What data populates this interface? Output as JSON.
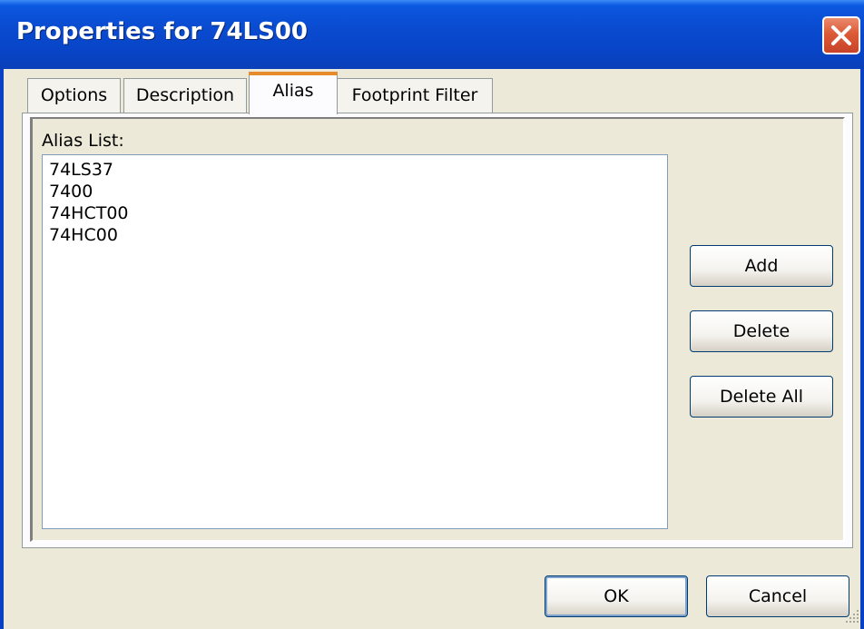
{
  "window": {
    "title": "Properties for 74LS00"
  },
  "tabs": [
    {
      "label": "Options",
      "active": false
    },
    {
      "label": "Description",
      "active": false
    },
    {
      "label": "Alias",
      "active": true
    },
    {
      "label": "Footprint Filter",
      "active": false
    }
  ],
  "alias_panel": {
    "list_label": "Alias List:",
    "items": [
      "74LS37",
      "7400",
      "74HCT00",
      "74HC00"
    ],
    "buttons": {
      "add": "Add",
      "delete": "Delete",
      "delete_all": "Delete All"
    }
  },
  "footer": {
    "ok": "OK",
    "cancel": "Cancel"
  },
  "colors": {
    "titlebar": "#0A4BD0",
    "dialog_bg": "#ECE9D8",
    "active_tab_accent": "#E68B2C",
    "close_button": "#DC5A36"
  },
  "icons": {
    "close": "close-x-icon",
    "resize": "resize-grip-icon"
  }
}
